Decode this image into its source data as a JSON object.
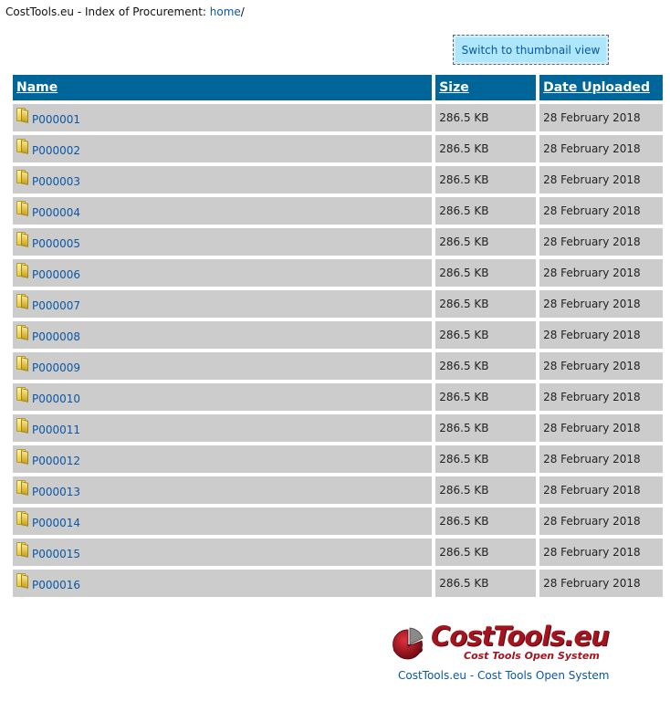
{
  "breadcrumb": {
    "prefix": "CostTools.eu - Index of Procurement: ",
    "home_link": "home",
    "suffix": "/"
  },
  "view_switch": {
    "label": "Switch to thumbnail view"
  },
  "table": {
    "headers": {
      "name": "Name",
      "size": "Size",
      "date": "Date Uploaded"
    },
    "rows": [
      {
        "name": "P000001",
        "size": "286.5 KB",
        "date": "28 February 2018"
      },
      {
        "name": "P000002",
        "size": "286.5 KB",
        "date": "28 February 2018"
      },
      {
        "name": "P000003",
        "size": "286.5 KB",
        "date": "28 February 2018"
      },
      {
        "name": "P000004",
        "size": "286.5 KB",
        "date": "28 February 2018"
      },
      {
        "name": "P000005",
        "size": "286.5 KB",
        "date": "28 February 2018"
      },
      {
        "name": "P000006",
        "size": "286.5 KB",
        "date": "28 February 2018"
      },
      {
        "name": "P000007",
        "size": "286.5 KB",
        "date": "28 February 2018"
      },
      {
        "name": "P000008",
        "size": "286.5 KB",
        "date": "28 February 2018"
      },
      {
        "name": "P000009",
        "size": "286.5 KB",
        "date": "28 February 2018"
      },
      {
        "name": "P000010",
        "size": "286.5 KB",
        "date": "28 February 2018"
      },
      {
        "name": "P000011",
        "size": "286.5 KB",
        "date": "28 February 2018"
      },
      {
        "name": "P000012",
        "size": "286.5 KB",
        "date": "28 February 2018"
      },
      {
        "name": "P000013",
        "size": "286.5 KB",
        "date": "28 February 2018"
      },
      {
        "name": "P000014",
        "size": "286.5 KB",
        "date": "28 February 2018"
      },
      {
        "name": "P000015",
        "size": "286.5 KB",
        "date": "28 February 2018"
      },
      {
        "name": "P000016",
        "size": "286.5 KB",
        "date": "28 February 2018"
      }
    ]
  },
  "footer": {
    "logo_text": "CostTools.eu",
    "logo_subtitle": "Cost Tools Open System",
    "link_text": "CostTools.eu - Cost Tools Open System"
  },
  "colors": {
    "header_bg": "#006699",
    "row_bg": "#cccccc",
    "link": "#0a57a4",
    "brand": "#a3141e",
    "switch_bg": "#aee6fb"
  },
  "icons": {
    "row_icon": "folder-icon",
    "logo_icon": "pie-chart-icon"
  }
}
